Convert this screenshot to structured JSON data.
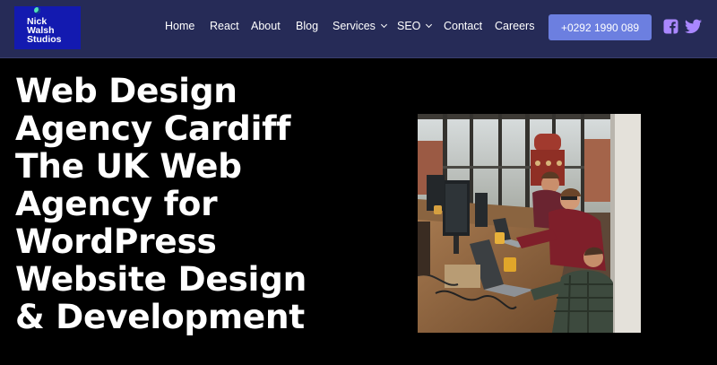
{
  "brand": {
    "lines": [
      "Nick",
      "Walsh",
      "Studios"
    ],
    "colors": {
      "logo_bg": "#131ab0",
      "header_bg": "#262b57",
      "accent": "#6c7fe0",
      "social": "#a987ff"
    }
  },
  "nav": {
    "items": [
      {
        "label": "Home",
        "dropdown": false
      },
      {
        "label": "React",
        "dropdown": false
      },
      {
        "label": "About",
        "dropdown": false
      },
      {
        "label": "Blog",
        "dropdown": false
      },
      {
        "label": "Services",
        "dropdown": true
      },
      {
        "label": "SEO",
        "dropdown": true
      },
      {
        "label": "Contact",
        "dropdown": false
      },
      {
        "label": "Careers",
        "dropdown": false
      }
    ],
    "phone": "+0292 1990 089",
    "social_icons": [
      "facebook-icon",
      "twitter-icon"
    ]
  },
  "hero": {
    "title_lines": [
      "Web Design",
      "Agency Cardiff",
      "The UK Web",
      "Agency for",
      "WordPress",
      "Website Design",
      "& Development"
    ]
  }
}
